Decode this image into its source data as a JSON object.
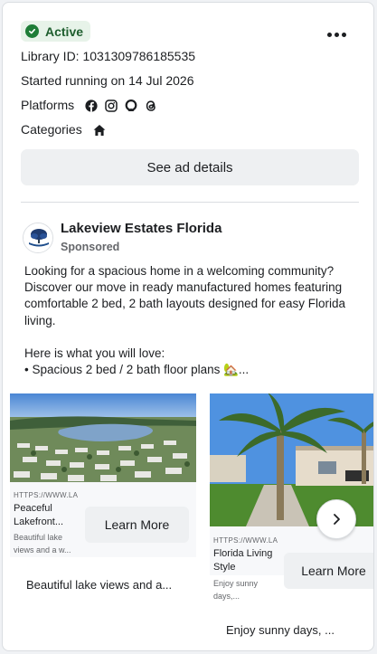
{
  "status": {
    "label": "Active",
    "color": "#1e7d37"
  },
  "meta": {
    "library_id": "Library ID: 1031309786185535",
    "started": "Started running on 14 Jul 2026",
    "platforms_label": "Platforms",
    "platform_icons": [
      "facebook-icon",
      "instagram-icon",
      "audience-network-icon",
      "threads-icon"
    ],
    "categories_label": "Categories",
    "category_icon": "home-icon"
  },
  "see_ad_details": "See ad details",
  "ad": {
    "advertiser": "Lakeview Estates Florida",
    "sponsored": "Sponsored",
    "body_lines": [
      "Looking for a spacious home in a welcoming community? Discover our move in ready manufactured homes featuring comfortable 2 bed, 2 bath layouts designed for easy Florida living.",
      "",
      "Here is what you will love:",
      "• Spacious 2 bed / 2 bath floor plans 🏡..."
    ]
  },
  "carousel": [
    {
      "url": "HTTPS://WWW.LA",
      "title": "Peaceful Lakefront...",
      "description": "Beautiful lake views and a w...",
      "cta": "Learn More",
      "caption": "Beautiful lake views and a..."
    },
    {
      "url": "HTTPS://WWW.LA",
      "title": "Florida Living Style",
      "description": "Enjoy sunny days,...",
      "cta": "Learn More",
      "caption": "Enjoy sunny days, ..."
    }
  ],
  "colors": {
    "accent_bg": "#e7f3e9",
    "button_bg": "#eef0f2",
    "sky": "#5c9ce6",
    "grass": "#4e8b2f"
  }
}
